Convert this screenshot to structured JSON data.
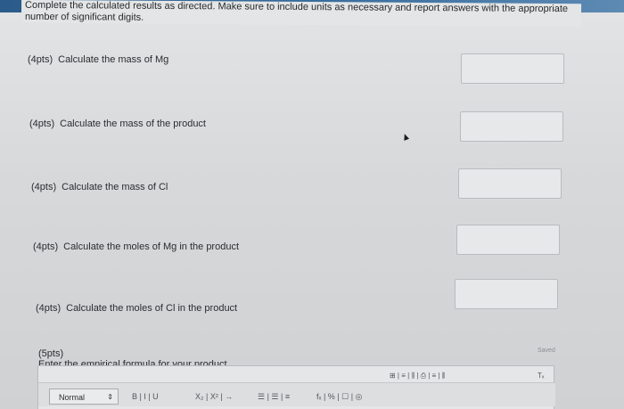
{
  "instructions": "Complete the calculated results as directed. Make sure to include units as necessary and report answers with the appropriate number of significant digits.",
  "questions": [
    {
      "points": "(4pts)",
      "text": "Calculate the mass of Mg"
    },
    {
      "points": "(4pts)",
      "text": "Calculate the mass of the product"
    },
    {
      "points": "(4pts)",
      "text": "Calculate the mass of Cl"
    },
    {
      "points": "(4pts)",
      "text": "Calculate the moles of Mg in the product"
    },
    {
      "points": "(4pts)",
      "text": "Calculate the moles of Cl in the product"
    }
  ],
  "final_question": {
    "points": "(5pts)",
    "text": "Enter the empirical formula for your product."
  },
  "editor": {
    "saved_label": "Saved",
    "format_select": "Normal",
    "select_arrow": "⇕",
    "text_styles": "B | I | U",
    "scripts": "X₂ | X² | →",
    "lists": "☰ | ☰ | ≡",
    "insert_tools": "fₓ | % | ☐ | ◎",
    "table_tools": "⊞ | ≡ | ⫼ | ⎙ | ≡ | ⫼",
    "clear_format": "Tₓ"
  }
}
